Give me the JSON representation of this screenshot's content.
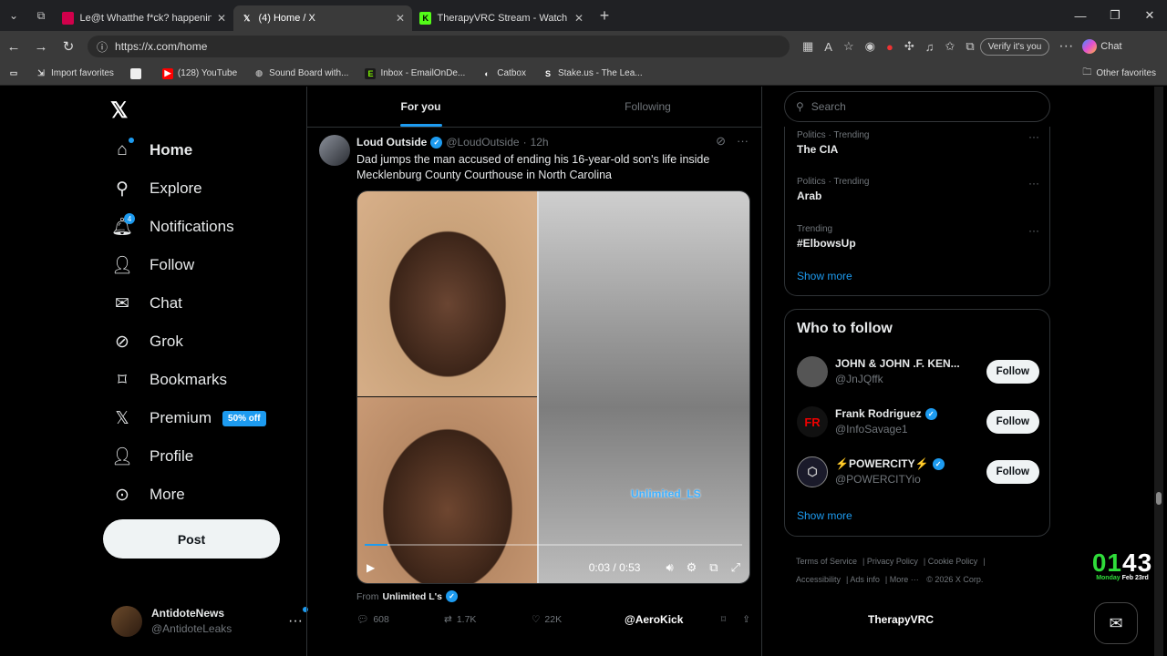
{
  "browser": {
    "tabs": [
      {
        "label": "Le@t Whatthe f*ck? happening in",
        "favicon_color": "#d1004b",
        "active": false
      },
      {
        "label": "(4) Home / X",
        "favicon_color": "#000000",
        "active": true
      },
      {
        "label": "TherapyVRC Stream - Watch Live",
        "favicon_color": "#53fc18",
        "active": false
      }
    ],
    "new_tab": "+",
    "url": "https://x.com/home",
    "verify_label": "Verify it's you",
    "chat_label": "Chat",
    "bookmarks": [
      {
        "label": "Import favorites",
        "icon": "import-icon"
      },
      {
        "label": "",
        "icon": "page-icon"
      },
      {
        "label": "(128) YouTube",
        "icon": "youtube-icon"
      },
      {
        "label": "Sound Board with...",
        "icon": "soundboard-icon"
      },
      {
        "label": "Inbox - EmailOnDe...",
        "icon": "inbox-icon"
      },
      {
        "label": "Catbox",
        "icon": "catbox-icon"
      },
      {
        "label": "Stake.us - The Lea...",
        "icon": "stake-icon"
      }
    ],
    "other_favorites": "Other favorites"
  },
  "nav": {
    "items": [
      {
        "label": "Home",
        "icon": "home-icon"
      },
      {
        "label": "Explore",
        "icon": "search-icon"
      },
      {
        "label": "Notifications",
        "icon": "bell-icon",
        "badge": "4"
      },
      {
        "label": "Follow",
        "icon": "follow-icon"
      },
      {
        "label": "Chat",
        "icon": "mail-icon"
      },
      {
        "label": "Grok",
        "icon": "grok-icon"
      },
      {
        "label": "Bookmarks",
        "icon": "bookmark-icon"
      },
      {
        "label": "Premium",
        "icon": "x-icon",
        "badge": "50% off"
      },
      {
        "label": "Profile",
        "icon": "person-icon"
      },
      {
        "label": "More",
        "icon": "more-circle-icon"
      }
    ],
    "post_label": "Post",
    "account": {
      "display_name": "AntidoteNews",
      "handle": "@AntidoteLeaks"
    }
  },
  "feed": {
    "tabs": [
      "For you",
      "Following"
    ],
    "tweet": {
      "display_name": "Loud Outside",
      "handle": "@LoudOutside",
      "time": "12h",
      "text": "Dad jumps the man accused of ending his 16-year-old son's life inside Mecklenburg County Courthouse in North Carolina",
      "watermark": "Unlimited_LS",
      "video_time": "0:03 / 0:53",
      "video_progress": 0.06,
      "from_prefix": "From",
      "from_name": "Unlimited L's",
      "replies": "608",
      "reposts": "1.7K",
      "likes": "22K",
      "views": "@AeroKick"
    }
  },
  "overlay": {
    "streamer": "TherapyVRC",
    "clock_hour": "01",
    "clock_min": "43",
    "clock_day": "Monday",
    "clock_date": "Feb 23rd"
  },
  "right": {
    "search_placeholder": "Search",
    "trends": [
      {
        "category": "Politics · Trending",
        "title": "The CIA"
      },
      {
        "category": "Politics · Trending",
        "title": "Arab"
      },
      {
        "category": "Trending",
        "title": "#ElbowsUp"
      }
    ],
    "show_more": "Show more",
    "who_to_follow_title": "Who to follow",
    "who_to_follow": [
      {
        "name": "JOHN & JOHN .F. KEN...",
        "handle": "@JnJQffk",
        "verified": false
      },
      {
        "name": "Frank Rodriguez",
        "handle": "@InfoSavage1",
        "verified": true
      },
      {
        "name": "⚡POWERCITY⚡",
        "handle": "@POWERCITYio",
        "verified": true
      }
    ],
    "follow_label": "Follow",
    "footer": [
      "Terms of Service",
      "Privacy Policy",
      "Cookie Policy",
      "Accessibility",
      "Ads info",
      "More ···",
      "© 2026 X Corp."
    ]
  }
}
